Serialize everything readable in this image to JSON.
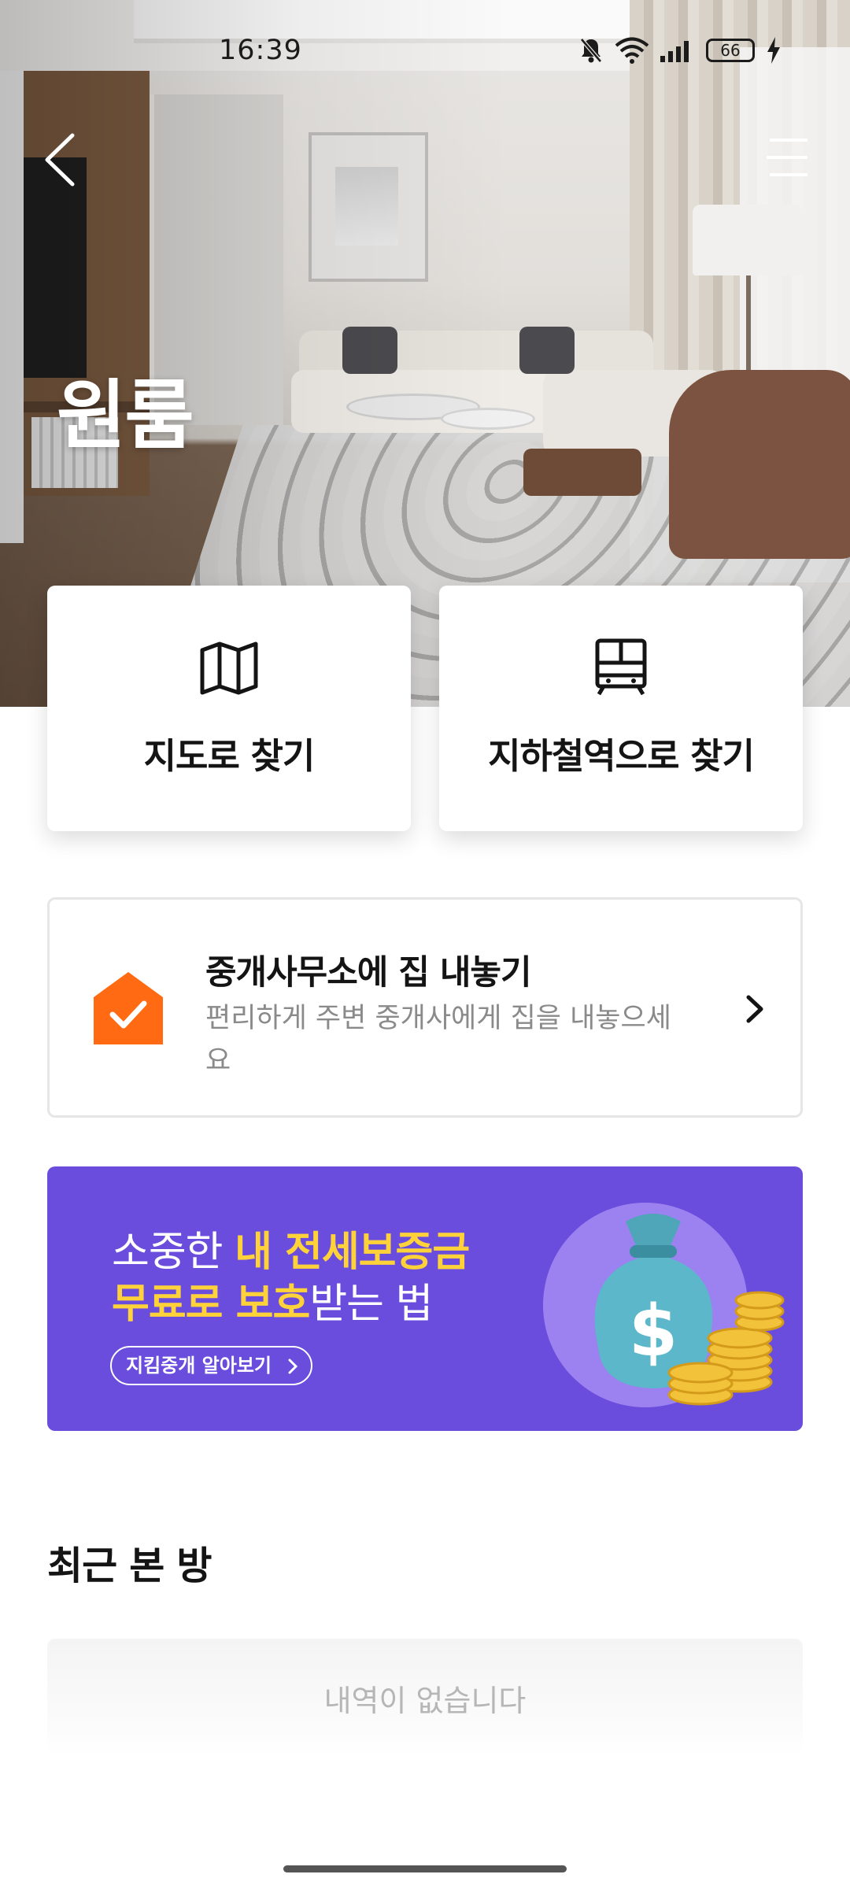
{
  "status_bar": {
    "time": "16:39",
    "battery": "66",
    "icons": [
      "bell-muted-icon",
      "wifi-icon",
      "signal-icon",
      "battery-icon",
      "charging-icon"
    ]
  },
  "hero": {
    "title": "원룸",
    "back_icon": "chevron-left-icon",
    "menu_icon": "hamburger-menu-icon"
  },
  "search_cards": [
    {
      "label": "지도로 찾기",
      "icon": "map-icon"
    },
    {
      "label": "지하철역으로 찾기",
      "icon": "subway-train-icon"
    }
  ],
  "listing_banner": {
    "title": "중개사무소에 집 내놓기",
    "description": "편리하게 주변 중개사에게 집을 내놓으세요",
    "icon": "house-check-icon",
    "accent": "#ff6a13"
  },
  "promo_banner": {
    "line1_normal": "소중한 ",
    "line1_highlight": "내 전세보증금",
    "line2_highlight": "무료로 보호",
    "line2_normal": "받는 법",
    "button_label": "지킴중개 알아보기",
    "background": "#6a4ddc",
    "highlight_color": "#ffd23a",
    "art_icon": "money-bag-coins-icon"
  },
  "recent": {
    "title": "최근 본 방",
    "empty_text": "내역이 없습니다"
  }
}
